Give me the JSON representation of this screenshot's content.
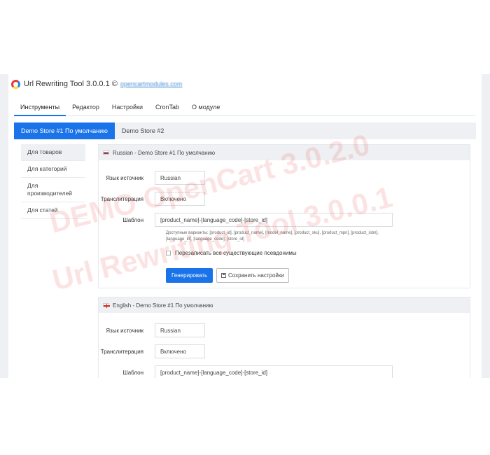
{
  "app": {
    "title": "Url Rewriting Tool 3.0.0.1 ©",
    "link": "opencartmodules.com"
  },
  "main_tabs": [
    {
      "label": "Инструменты"
    },
    {
      "label": "Редактор"
    },
    {
      "label": "Настройки"
    },
    {
      "label": "CronTab"
    },
    {
      "label": "О модуле"
    }
  ],
  "store_tabs": [
    {
      "label": "Demo Store #1 По умолчанию"
    },
    {
      "label": "Demo Store #2"
    }
  ],
  "left_nav": [
    {
      "label": "Для товаров"
    },
    {
      "label": "Для категорий"
    },
    {
      "label": "Для производителей"
    },
    {
      "label": "Для статей"
    }
  ],
  "sections": [
    {
      "header": "Russian - Demo Store #1 По умолчанию",
      "source_lang_label": "Язык источник",
      "source_lang_value": "Russian",
      "translit_label": "Транслитерация",
      "translit_value": "Включено",
      "template_label": "Шаблон",
      "template_value": "[product_name]-[language_code]-[store_id]",
      "help_text": "Доступные варианты: [product_id], [product_name], [model_name], [product_sku], [product_mpn], [product_isbn], [language_id], [language_code], [store_id]",
      "overwrite_label": "Перезаписать все существующие псевдонимы",
      "generate_button": "Генерировать",
      "save_button": "Сохранить настройки"
    },
    {
      "header": "English - Demo Store #1 По умолчанию",
      "source_lang_label": "Язык источник",
      "source_lang_value": "Russian",
      "translit_label": "Транслитерация",
      "translit_value": "Включено",
      "template_label": "Шаблон",
      "template_value": "[product_name]-[language_code]-[store_id]"
    }
  ],
  "watermark": {
    "line1": "DEMO OpenCart 3.0.2.0",
    "line2": "Url Rewriting Tool 3.0.0.1"
  },
  "colors": {
    "accent": "#1a73e8",
    "panel_gray": "#eef0f3",
    "watermark": "#eb4646"
  }
}
